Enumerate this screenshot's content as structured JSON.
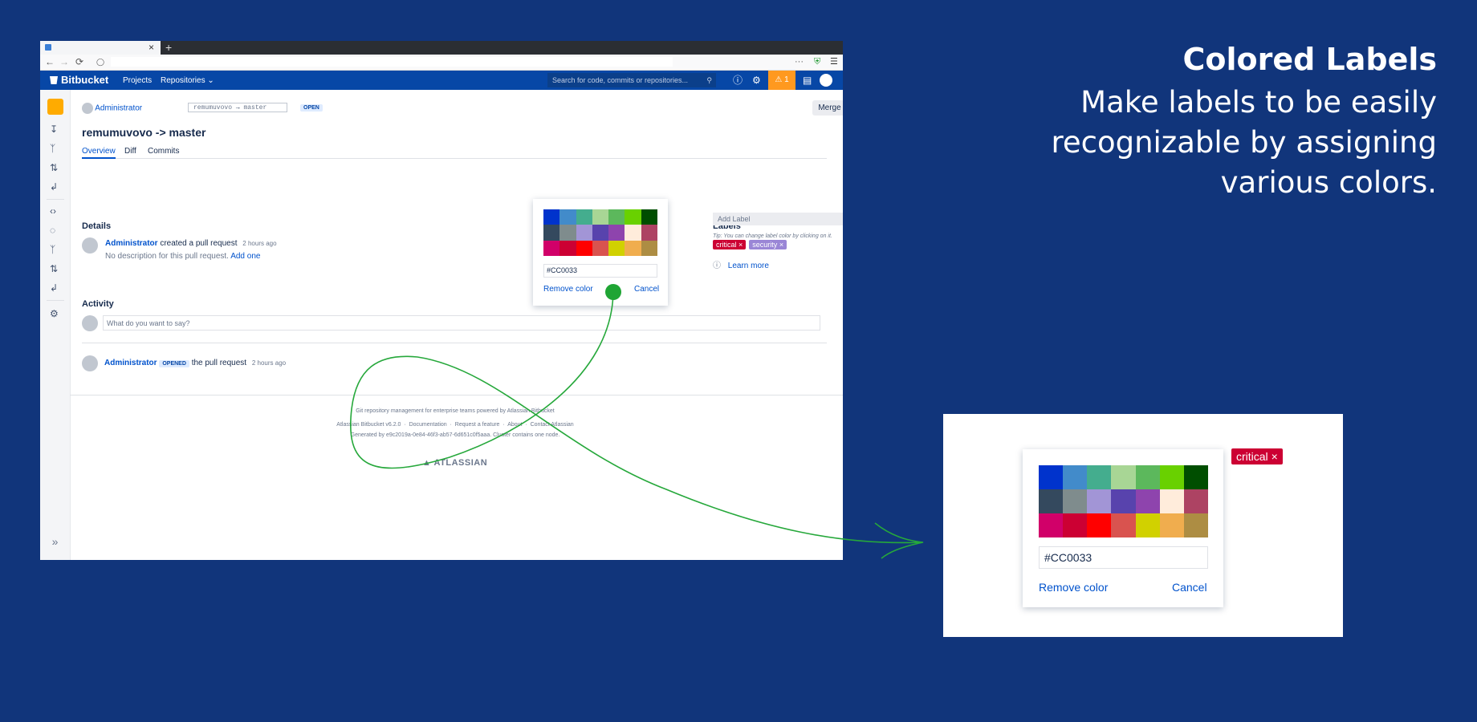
{
  "promo": {
    "title": "Colored Labels",
    "subtitle": "Make labels to be easily recognizable by assigning various colors."
  },
  "browser": {
    "tab_close": "×",
    "tab_new": "+",
    "nav_back": "←",
    "nav_forward": "→",
    "nav_reload": "⟳",
    "nav_menu": "☰",
    "nav_more": "···"
  },
  "header": {
    "logo": "Bitbucket",
    "menu_projects": "Projects",
    "menu_repositories": "Repositories",
    "search_placeholder": "Search for code, commits or repositories...",
    "warning_count": "1"
  },
  "pr": {
    "author": "Administrator",
    "branch_from": "remumuvovo",
    "branch_to": "master",
    "branch_arrow": "→",
    "state": "OPEN",
    "merge_label": "Merge",
    "more_label": "···",
    "title": "remumuvovo -> master",
    "tabs": [
      "Overview",
      "Diff",
      "Commits"
    ]
  },
  "details": {
    "heading": "Details",
    "author": "Administrator",
    "action": "created a pull request",
    "time": "2 hours ago",
    "description": "No description for this pull request.",
    "add_one": "Add one"
  },
  "labels": {
    "heading": "Labels",
    "items": [
      {
        "name": "critical",
        "color": "#CC0033"
      },
      {
        "name": "security",
        "color": "#9A86D6"
      }
    ],
    "remove_glyph": "×",
    "add_placeholder": "Add Label",
    "tip": "Tip: You can change label color by clicking on it.",
    "learn_more": "Learn more"
  },
  "color_picker": {
    "colors": [
      "#0033CC",
      "#428BCA",
      "#44AD8E",
      "#A8D695",
      "#5CB85C",
      "#69D100",
      "#004E00",
      "#34495E",
      "#7F8C8D",
      "#A295D6",
      "#5843AD",
      "#8E44AD",
      "#FFECDB",
      "#AD4363",
      "#D10069",
      "#CC0033",
      "#FF0000",
      "#D9534F",
      "#D1D100",
      "#F0AD4E",
      "#AD8D43"
    ],
    "hex_value": "#CC0033",
    "remove_label": "Remove color",
    "cancel_label": "Cancel"
  },
  "activity": {
    "heading": "Activity",
    "input_placeholder": "What do you want to say?",
    "author": "Administrator",
    "badge": "OPENED",
    "action": "the pull request",
    "time": "2 hours ago"
  },
  "footer": {
    "line1": "Git repository management for enterprise teams powered by Atlassian Bitbucket",
    "version": "Atlassian Bitbucket v6.2.0",
    "documentation": "Documentation",
    "request_feature": "Request a feature",
    "about": "About",
    "contact": "Contact Atlassian",
    "generated": "Generated by e9c2019a-0e84-46f3-ab57-6d651c0f5aaa. Cluster contains one node.",
    "brand": "ATLASSIAN"
  },
  "zoom": {
    "label": "critical",
    "label_color": "#CC0033",
    "hex_value": "#CC0033",
    "remove_label": "Remove color",
    "cancel_label": "Cancel"
  }
}
